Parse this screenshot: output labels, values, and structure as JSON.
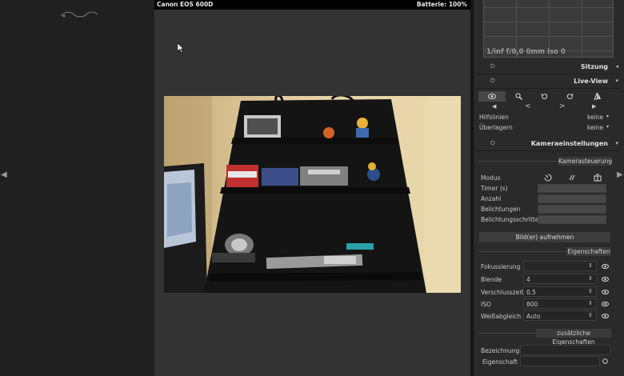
{
  "topbar": {
    "camera": "Canon EOS 600D",
    "battery": "Batterie: 100%"
  },
  "histogram": {
    "info": "1/inf f/0,0 0mm iso 0"
  },
  "modules": {
    "sitzung": {
      "title": "Sitzung"
    },
    "liveview": {
      "title": "Live-View",
      "hilfslinien_label": "Hilfslinien",
      "hilfslinien_value": "keine",
      "ueberlagern_label": "Überlagern",
      "ueberlagern_value": "keine",
      "prev_label": "<",
      "next_label": ">"
    },
    "kamera": {
      "title": "Kameraeinstellungen",
      "section_control": "Kamerasteuerung",
      "modus_label": "Modus",
      "timer_label": "Timer (s)",
      "anzahl_label": "Anzahl",
      "belichtungen_label": "Belichtungen",
      "schritte_label": "Belichtungsschritte",
      "capture_button": "Bild(er) aufnehmen",
      "section_props": "Eigenschaften",
      "props": [
        {
          "label": "Fokussierung",
          "value": ""
        },
        {
          "label": "Blende",
          "value": "4"
        },
        {
          "label": "Verschlusszeit",
          "value": "0.5"
        },
        {
          "label": "ISO",
          "value": "800"
        },
        {
          "label": "Weißabgleich",
          "value": "Auto"
        }
      ],
      "section_extra": "zusätzliche Eigenschaften",
      "bezeichnung_label": "Bezeichnung",
      "eigenschaft_label": "Eigenschaft"
    }
  },
  "icons": {
    "left_arrow": "◀",
    "right_arrow": "▶",
    "power": "⏻",
    "collapse": "◂",
    "expand": "▾",
    "updown": "⇕",
    "eye": "◉"
  }
}
